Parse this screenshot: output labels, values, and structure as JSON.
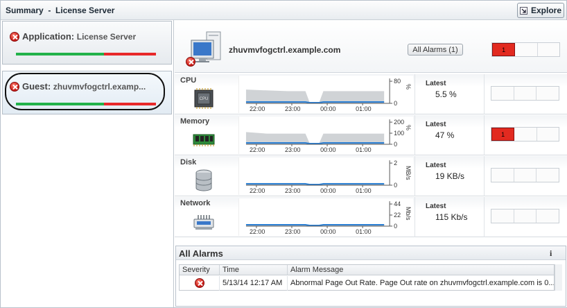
{
  "header": {
    "title": "Summary  -  License Server",
    "explore_label": "Explore"
  },
  "left_panel": {
    "cards": [
      {
        "title": "Application:",
        "subtitle": "License Server",
        "health": {
          "ok": 0.63,
          "bad": 0.37
        }
      },
      {
        "title": "Guest:",
        "subtitle": "zhuvmvfogctrl.examp...",
        "health": {
          "ok": 0.63,
          "bad": 0.37
        }
      }
    ]
  },
  "host": {
    "name": "zhuvmvfogctrl.example.com",
    "all_alarms_label": "All Alarms (1)",
    "severity_counts": [
      "1",
      "",
      ""
    ]
  },
  "metrics": [
    {
      "label": "CPU",
      "latest_label": "Latest",
      "latest_value": "5.5 %",
      "y_ticks": [
        "80",
        "0"
      ],
      "unit": "%",
      "x_ticks": [
        "22:00",
        "23:00",
        "00:00",
        "01:00"
      ],
      "severity_counts": [
        "",
        "",
        ""
      ]
    },
    {
      "label": "Memory",
      "latest_label": "Latest",
      "latest_value": "47 %",
      "y_ticks": [
        "200",
        "100",
        "0"
      ],
      "unit": "%",
      "x_ticks": [
        "22:00",
        "23:00",
        "00:00",
        "01:00"
      ],
      "severity_counts": [
        "1",
        "",
        ""
      ]
    },
    {
      "label": "Disk",
      "latest_label": "Latest",
      "latest_value": "19 KB/s",
      "y_ticks": [
        "2",
        "0"
      ],
      "unit": "MB/s",
      "x_ticks": [
        "22:00",
        "23:00",
        "00:00",
        "01:00"
      ],
      "severity_counts": [
        "",
        "",
        ""
      ]
    },
    {
      "label": "Network",
      "latest_label": "Latest",
      "latest_value": "115 Kb/s",
      "y_ticks": [
        "44",
        "22",
        "0"
      ],
      "unit": "Mb/s",
      "x_ticks": [
        "22:00",
        "23:00",
        "00:00",
        "01:00"
      ],
      "severity_counts": [
        "",
        "",
        ""
      ]
    }
  ],
  "alarms": {
    "title": "All Alarms",
    "info_label": "i",
    "columns": [
      "Severity",
      "Time",
      "Alarm Message"
    ],
    "rows": [
      {
        "time": "5/13/14 12:17 AM",
        "message": "Abnormal Page Out Rate. Page Out rate on zhuvmvfogctrl.example.com is 0..."
      }
    ]
  },
  "colors": {
    "ok": "#22b24a",
    "bad": "#e8282a",
    "critical": "#e22a20",
    "series_fill": "#d0d3d6",
    "series_line": "#2a7fd4"
  }
}
